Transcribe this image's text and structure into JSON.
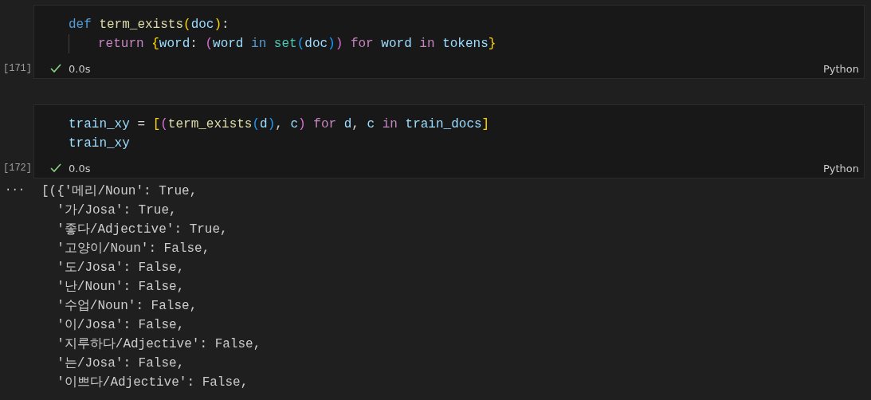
{
  "cells": [
    {
      "execution_count": "[171]",
      "succeeded": true,
      "duration": "0.0s",
      "language": "Python",
      "lines": [
        {
          "indented": false,
          "tokens": [
            {
              "text": "def ",
              "kind": "keyword"
            },
            {
              "text": "term_exists",
              "kind": "function"
            },
            {
              "text": "(",
              "kind": "bracket1"
            },
            {
              "text": "doc",
              "kind": "variable"
            },
            {
              "text": ")",
              "kind": "bracket1"
            },
            {
              "text": ":",
              "kind": "plain"
            }
          ]
        },
        {
          "indented": true,
          "tokens": [
            {
              "text": "return ",
              "kind": "control"
            },
            {
              "text": "{",
              "kind": "bracket1"
            },
            {
              "text": "word",
              "kind": "variable"
            },
            {
              "text": ": ",
              "kind": "plain"
            },
            {
              "text": "(",
              "kind": "bracket2"
            },
            {
              "text": "word",
              "kind": "variable"
            },
            {
              "text": " in ",
              "kind": "keyword"
            },
            {
              "text": "set",
              "kind": "builtin"
            },
            {
              "text": "(",
              "kind": "bracket3"
            },
            {
              "text": "doc",
              "kind": "variable"
            },
            {
              "text": ")",
              "kind": "bracket3"
            },
            {
              "text": ")",
              "kind": "bracket2"
            },
            {
              "text": " for ",
              "kind": "control"
            },
            {
              "text": "word",
              "kind": "variable"
            },
            {
              "text": " in ",
              "kind": "control"
            },
            {
              "text": "tokens",
              "kind": "variable"
            },
            {
              "text": "}",
              "kind": "bracket1"
            }
          ]
        }
      ]
    },
    {
      "execution_count": "[172]",
      "succeeded": true,
      "duration": "0.0s",
      "language": "Python",
      "lines": [
        {
          "indented": false,
          "tokens": [
            {
              "text": "train_xy",
              "kind": "variable"
            },
            {
              "text": " = ",
              "kind": "plain"
            },
            {
              "text": "[",
              "kind": "bracket1"
            },
            {
              "text": "(",
              "kind": "bracket2"
            },
            {
              "text": "term_exists",
              "kind": "function"
            },
            {
              "text": "(",
              "kind": "bracket3"
            },
            {
              "text": "d",
              "kind": "variable"
            },
            {
              "text": ")",
              "kind": "bracket3"
            },
            {
              "text": ", ",
              "kind": "plain"
            },
            {
              "text": "c",
              "kind": "variable"
            },
            {
              "text": ")",
              "kind": "bracket2"
            },
            {
              "text": " for ",
              "kind": "control"
            },
            {
              "text": "d",
              "kind": "variable"
            },
            {
              "text": ", ",
              "kind": "plain"
            },
            {
              "text": "c",
              "kind": "variable"
            },
            {
              "text": " in ",
              "kind": "control"
            },
            {
              "text": "train_docs",
              "kind": "variable"
            },
            {
              "text": "]",
              "kind": "bracket1"
            }
          ]
        },
        {
          "indented": false,
          "tokens": [
            {
              "text": "train_xy",
              "kind": "variable"
            }
          ]
        }
      ],
      "output": {
        "more": "···",
        "lines": [
          "[({'메리/Noun': True,",
          "  '가/Josa': True,",
          "  '좋다/Adjective': True,",
          "  '고양이/Noun': False,",
          "  '도/Josa': False,",
          "  '난/Noun': False,",
          "  '수업/Noun': False,",
          "  '이/Josa': False,",
          "  '지루하다/Adjective': False,",
          "  '는/Josa': False,",
          "  '이쁘다/Adjective': False,"
        ]
      }
    }
  ]
}
